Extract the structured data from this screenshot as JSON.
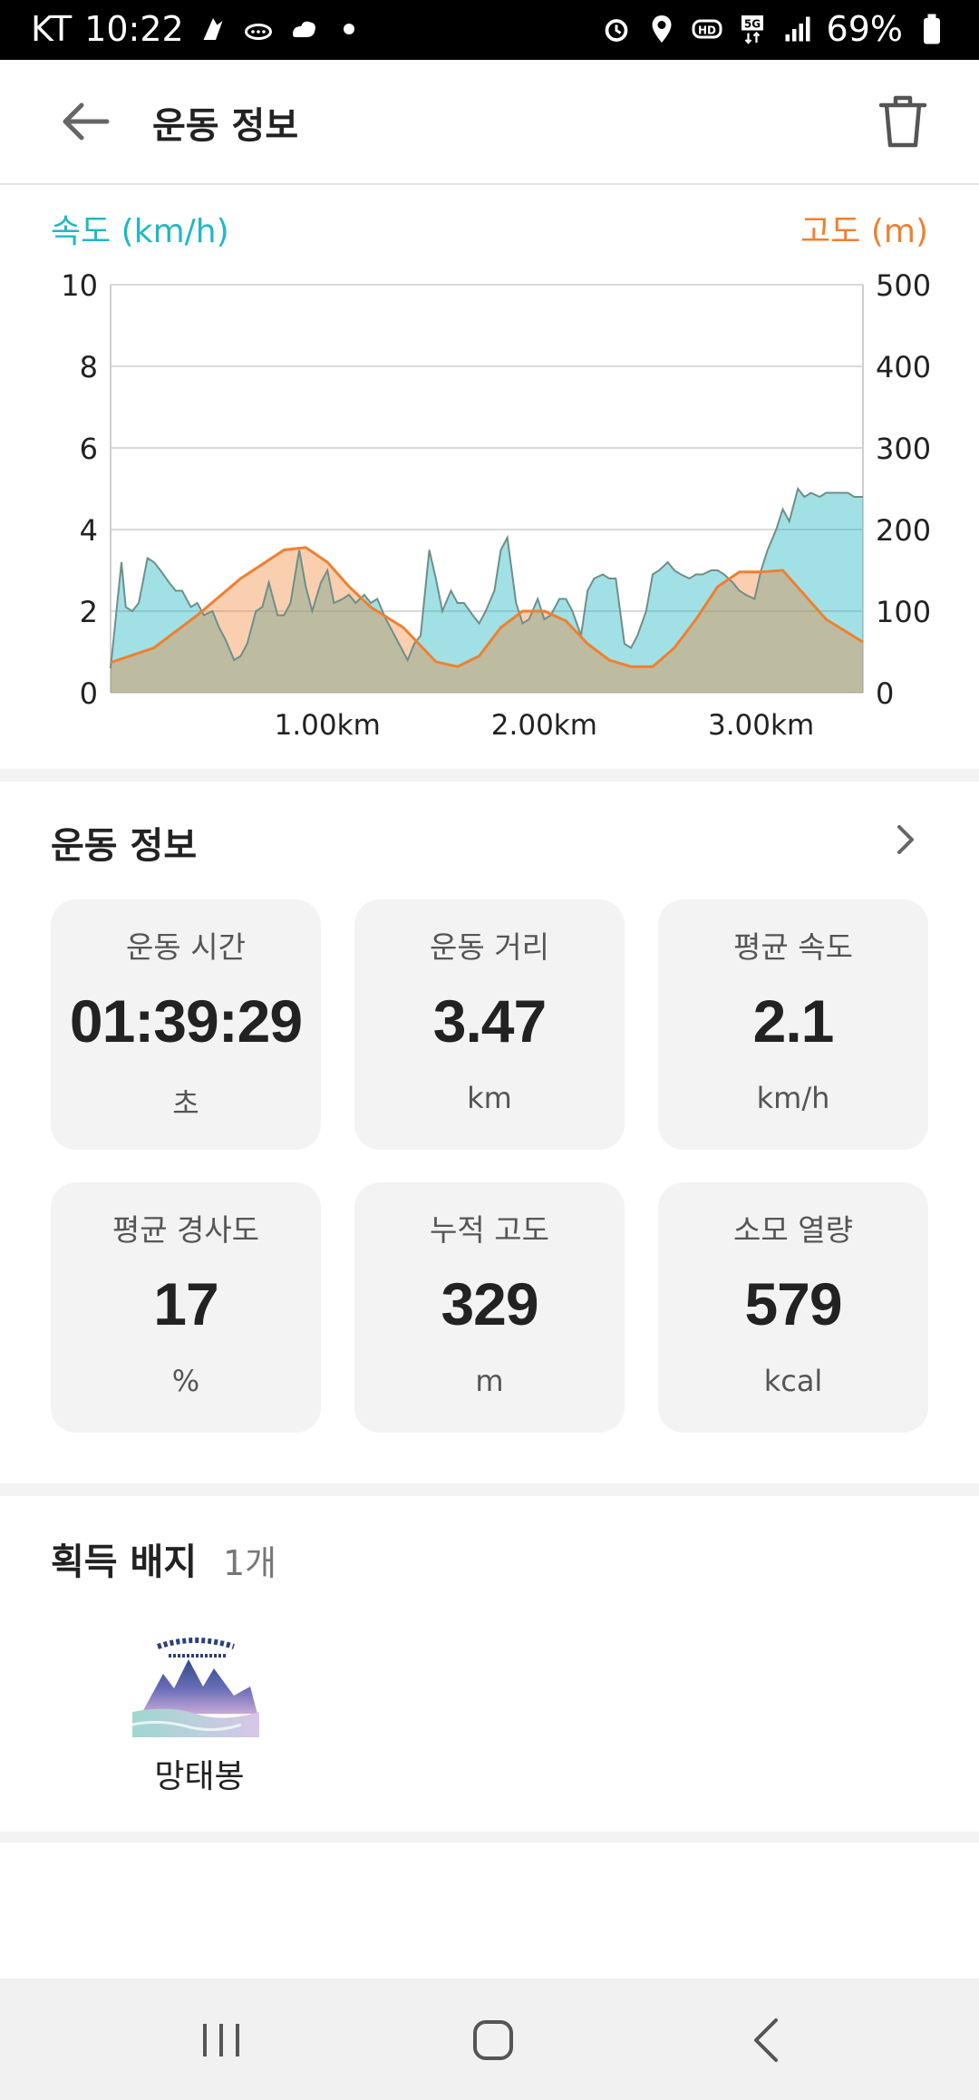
{
  "status": {
    "carrier": "KT",
    "time": "10:22",
    "battery": "69%"
  },
  "header": {
    "title": "운동 정보"
  },
  "chart_data": {
    "type": "area",
    "left_axis_label": "속도 (km/h)",
    "right_axis_label": "고도 (m)",
    "left_ticks": [
      "0",
      "2",
      "4",
      "6",
      "8",
      "10"
    ],
    "right_ticks": [
      "0",
      "100",
      "200",
      "300",
      "400",
      "500"
    ],
    "x_ticks": [
      "1.00km",
      "2.00km",
      "3.00km"
    ],
    "xlim": [
      0,
      3.47
    ],
    "ylim_left": [
      0,
      10
    ],
    "ylim_right": [
      0,
      500
    ],
    "colors": {
      "speed": "#1fb8c3",
      "altitude": "#ef8030"
    },
    "series": [
      {
        "axis": "left",
        "x": [
          0,
          0.05,
          0.07,
          0.1,
          0.13,
          0.17,
          0.2,
          0.23,
          0.27,
          0.3,
          0.33,
          0.37,
          0.4,
          0.43,
          0.47,
          0.5,
          0.53,
          0.57,
          0.6,
          0.63,
          0.67,
          0.7,
          0.73,
          0.77,
          0.8,
          0.83,
          0.87,
          0.9,
          0.93,
          0.97,
          1.0,
          1.03,
          1.07,
          1.1,
          1.13,
          1.17,
          1.2,
          1.23,
          1.27,
          1.3,
          1.33,
          1.37,
          1.4,
          1.43,
          1.47,
          1.5,
          1.53,
          1.57,
          1.6,
          1.63,
          1.67,
          1.7,
          1.73,
          1.77,
          1.8,
          1.83,
          1.87,
          1.9,
          1.93,
          1.97,
          2.0,
          2.03,
          2.07,
          2.1,
          2.13,
          2.17,
          2.2,
          2.23,
          2.27,
          2.3,
          2.33,
          2.37,
          2.4,
          2.43,
          2.47,
          2.5,
          2.53,
          2.57,
          2.6,
          2.63,
          2.67,
          2.7,
          2.73,
          2.77,
          2.8,
          2.83,
          2.87,
          2.9,
          2.93,
          2.97,
          3.0,
          3.03,
          3.07,
          3.1,
          3.13,
          3.17,
          3.2,
          3.23,
          3.27,
          3.3,
          3.33,
          3.37,
          3.4,
          3.43,
          3.47
        ],
        "values": [
          0.6,
          3.2,
          2.1,
          2.0,
          2.2,
          3.3,
          3.2,
          3.0,
          2.7,
          2.5,
          2.5,
          2.1,
          2.2,
          1.9,
          2.0,
          1.6,
          1.3,
          0.8,
          0.9,
          1.2,
          2.0,
          2.1,
          2.7,
          1.9,
          1.9,
          2.2,
          3.5,
          2.6,
          2.0,
          2.7,
          3.0,
          2.2,
          2.3,
          2.4,
          2.2,
          2.4,
          2.2,
          2.3,
          1.8,
          1.5,
          1.2,
          0.8,
          1.2,
          1.4,
          3.5,
          2.8,
          2.0,
          2.5,
          2.2,
          2.2,
          1.9,
          1.7,
          2.0,
          2.5,
          3.5,
          3.8,
          2.2,
          1.7,
          1.8,
          2.3,
          1.8,
          1.9,
          2.3,
          2.3,
          2.0,
          1.4,
          2.5,
          2.8,
          2.9,
          2.8,
          2.8,
          1.2,
          1.1,
          1.4,
          2.0,
          2.9,
          3.0,
          3.2,
          3.0,
          2.9,
          2.8,
          2.9,
          2.9,
          3.0,
          3.0,
          2.9,
          2.7,
          2.5,
          2.4,
          2.3,
          3.0,
          3.5,
          4.0,
          4.5,
          4.2,
          5.0,
          4.8,
          4.9,
          4.8,
          4.9,
          4.9,
          4.9,
          4.9,
          4.8,
          4.8
        ]
      },
      {
        "axis": "right",
        "x": [
          0,
          0.2,
          0.4,
          0.6,
          0.8,
          0.9,
          1.0,
          1.1,
          1.2,
          1.35,
          1.5,
          1.6,
          1.7,
          1.8,
          1.9,
          2.0,
          2.1,
          2.2,
          2.3,
          2.4,
          2.5,
          2.6,
          2.7,
          2.8,
          2.9,
          3.0,
          3.1,
          3.2,
          3.3,
          3.47
        ],
        "values": [
          37,
          55,
          95,
          140,
          175,
          178,
          160,
          130,
          105,
          80,
          38,
          32,
          45,
          80,
          100,
          100,
          88,
          60,
          40,
          32,
          32,
          55,
          90,
          130,
          148,
          148,
          150,
          120,
          90,
          62
        ]
      }
    ]
  },
  "exercise": {
    "title": "운동 정보",
    "cards": [
      {
        "label": "운동 시간",
        "value": "01:39:29",
        "unit": "초"
      },
      {
        "label": "운동 거리",
        "value": "3.47",
        "unit": "km"
      },
      {
        "label": "평균 속도",
        "value": "2.1",
        "unit": "km/h"
      },
      {
        "label": "평균 경사도",
        "value": "17",
        "unit": "%"
      },
      {
        "label": "누적 고도",
        "value": "329",
        "unit": "m"
      },
      {
        "label": "소모 열량",
        "value": "579",
        "unit": "kcal"
      }
    ]
  },
  "badges": {
    "title": "획득 배지",
    "count": "1개",
    "items": [
      {
        "name": "망태봉",
        "seal_text": "한려해상 국립공원 1968.12.31"
      }
    ]
  },
  "icons": {
    "back": "arrow-left-icon",
    "trash": "trash-icon",
    "chevron": "chevron-right-icon",
    "nav_recent": "recent-apps-icon",
    "nav_home": "home-icon",
    "nav_back": "nav-back-icon"
  }
}
